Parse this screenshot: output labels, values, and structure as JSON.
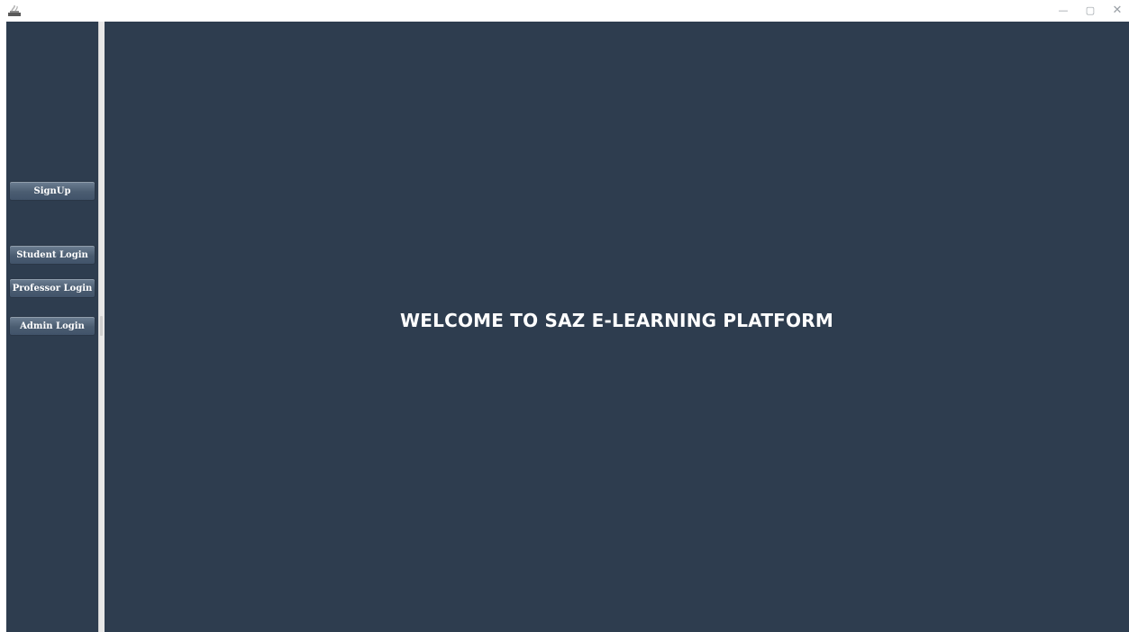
{
  "window": {
    "controls": {
      "minimize_glyph": "—",
      "maximize_glyph": "▢",
      "close_glyph": "✕"
    },
    "app_icon": "java-app-icon"
  },
  "sidebar": {
    "buttons": [
      {
        "id": "signup",
        "label": "SignUp"
      },
      {
        "id": "student-login",
        "label": "Student Login"
      },
      {
        "id": "professor-login",
        "label": "Professor Login"
      },
      {
        "id": "admin-login",
        "label": "Admin Login"
      }
    ]
  },
  "main": {
    "welcome_text": "WELCOME TO SAZ E-LEARNING PLATFORM"
  },
  "colors": {
    "background": "#2e3d4f",
    "divider": "#e8e8e8",
    "button": "#4b5d71",
    "text": "#ffffff"
  }
}
